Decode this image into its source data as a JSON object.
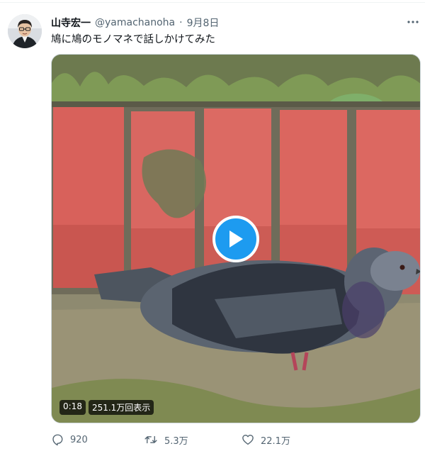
{
  "tweet": {
    "author_name": "山寺宏一",
    "handle": "@yamachanoha",
    "separator": "·",
    "date": "9月8日",
    "text": "鳩に鳩のモノマネで話しかけてみた"
  },
  "media": {
    "duration": "0:18",
    "views": "251.1万回表示",
    "play_icon": "play-icon"
  },
  "actions": {
    "reply_count": "920",
    "retweet_count": "5.3万",
    "like_count": "22.1万"
  },
  "icons": [
    "more-icon",
    "reply-icon",
    "retweet-icon",
    "like-icon",
    "play-icon"
  ],
  "colors": {
    "accent": "#1d9bf0",
    "secondary_text": "#536471",
    "brick": "#d8615b"
  }
}
